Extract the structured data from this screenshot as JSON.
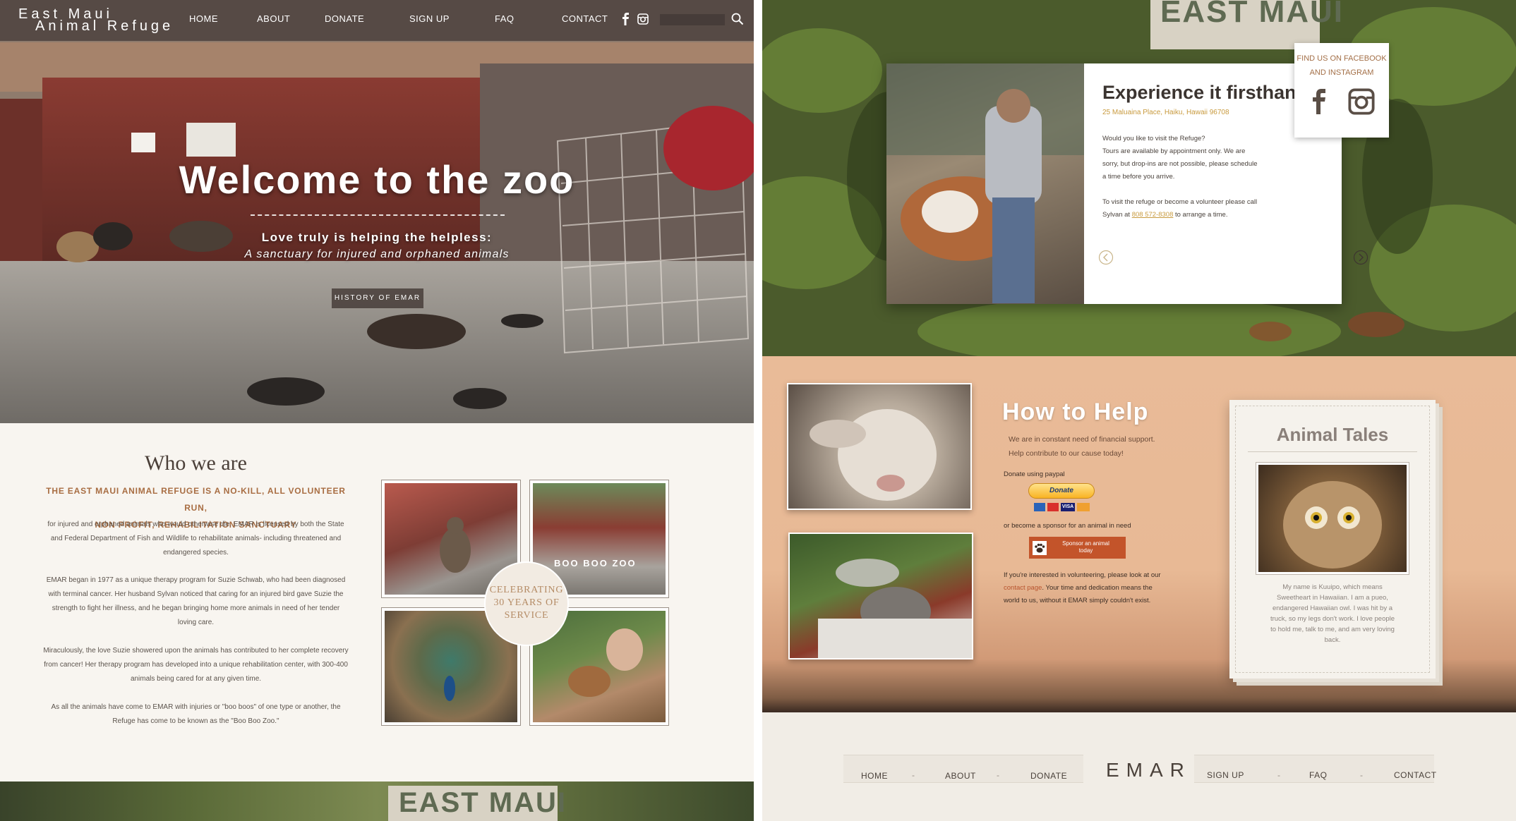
{
  "site": {
    "logo_line1": "East Maui",
    "logo_line2": "Animal Refuge"
  },
  "nav": {
    "items": [
      "HOME",
      "ABOUT",
      "DONATE",
      "SIGN UP",
      "FAQ",
      "CONTACT"
    ],
    "icons": [
      "facebook-icon",
      "instagram-icon",
      "search-icon"
    ]
  },
  "hero": {
    "title": "Welcome to the zoo",
    "subtitle1": "Love truly is helping the helpless:",
    "subtitle2": "A sanctuary for injured and orphaned animals",
    "button": "HISTORY OF EMAR",
    "sign": "East Maui Animal Refuge"
  },
  "who": {
    "title": "Who we are",
    "tagline1": "THE EAST MAUI ANIMAL REFUGE IS A NO-KILL, ALL VOLUNTEER RUN,",
    "tagline2": "NON PROFIT, REHABILITATION SANCTUARY",
    "p1": "for injured and orphaned animals who would otherwise die. EMAR is licensed by both the State and Federal Department of Fish and Wildlife to rehabilitate animals- including threatened and endangered species.",
    "p2": "EMAR began in 1977 as a unique therapy program for Suzie Schwab, who had been diagnosed with terminal cancer. Her husband Sylvan noticed that caring for an injured bird gave Suzie the strength to fight her illness, and he began bringing home more animals in need of her tender loving care.",
    "p3": "Miraculously, the love Suzie showered upon the animals has contributed to her complete recovery from cancer! Her therapy program has developed into a unique rehabilitation center, with 300-400 animals being cared for at any given time.",
    "p4": "As all the animals have come to EMAR with injuries or \"boo boos\" of one type or another, the Refuge has come to be known as the \"Boo Boo Zoo.\"",
    "photo_sign": "BOO BOO ZOO",
    "badge_line1": "CELEBRATING",
    "badge_line2": "30 YEARS OF",
    "badge_line3": "SERVICE"
  },
  "banner_sign": "EAST MAUI",
  "visit": {
    "title": "Experience it firsthand",
    "address": "25 Maluaina Place, Haiku, Hawaii 96708",
    "p1_line1": "Would you like to visit the Refuge?",
    "p1_line2": "Tours are available by appointment only. We are",
    "p1_line3": "sorry, but drop-ins are not possible, please schedule",
    "p1_line4": "a time before you arrive.",
    "p2_line1": "To visit the refuge or become a volunteer please call",
    "p2_before": "Sylvan at ",
    "phone": "808 572-8308",
    "p2_after": " to arrange a time.",
    "social_line1": "FIND US ON FACEBOOK",
    "social_line2": "AND INSTAGRAM"
  },
  "help": {
    "title": "How to Help",
    "line1": "We are in constant need of financial support.",
    "line2": "Help contribute to our cause today!",
    "paypal_label": "Donate using paypal",
    "paypal_button": "Donate",
    "card_logos": [
      "VISA"
    ],
    "sponsor_text": "or become a sponsor for an animal in need",
    "sponsor_button_line1": "Sponsor an animal",
    "sponsor_button_line2": "today",
    "vol_before": "If you're interested in volunteering, please look at our ",
    "vol_link": "contact page",
    "vol_after": ". Your time and dedication means the world to us, without it EMAR simply couldn't exist."
  },
  "tales": {
    "title": "Animal Tales",
    "text": "My name is Kuuipo, which means Sweetheart in Hawaiian. I am a pueo, endangered Hawaiian owl. I was hit by a truck, so my legs don't work. I love people to hold me, talk to me, and am very loving back."
  },
  "footer": {
    "left": [
      "HOME",
      "ABOUT",
      "DONATE"
    ],
    "right": [
      "SIGN UP",
      "FAQ",
      "CONTACT"
    ],
    "separator": "-",
    "logo": "EMAR"
  },
  "colors": {
    "accent_brown": "#a86d42",
    "gold": "#c89a3e",
    "peach": "#e9bb98",
    "sponsor_orange": "#c3542a"
  }
}
